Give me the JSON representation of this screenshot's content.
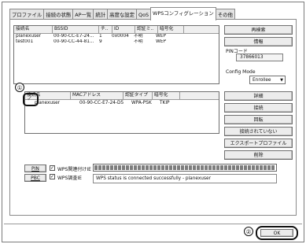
{
  "tabs": [
    "プロファイル",
    "接続の状態",
    "AP一覧",
    "統計",
    "高度な設定",
    "QoS",
    "WPSコンフィグレーション",
    "その他"
  ],
  "active_tab": 6,
  "ap_table": {
    "headers": [
      "接続名",
      "BSSID",
      "チ..",
      "ID",
      "認証ミ..",
      "暗号化"
    ],
    "rows": [
      [
        "planexuser",
        "00-90-CC-E7-24...",
        "1",
        "0x0004",
        "不明",
        "WEP"
      ],
      [
        "test001",
        "00-90-CC-44-81...",
        "9",
        "",
        "不明",
        "WEP"
      ]
    ]
  },
  "right_panel": {
    "rescan": "再検索",
    "info": "情報",
    "pin_code_label": "PINコード",
    "pin_code": "37866013",
    "config_mode_label": "Config Mode",
    "config_mode_value": "Enrollee"
  },
  "profile_table": {
    "headers": [
      "接続名",
      "MACアドレス",
      "認証タイプ",
      "暗号化"
    ],
    "rows": [
      [
        "planexuser",
        "00-90-CC-E7-24-D5",
        "WPA-PSK",
        "TKIP"
      ]
    ]
  },
  "profile_buttons": [
    "詳細",
    "接続",
    "回転",
    "接続されていない",
    "エクスポートプロファイル",
    "削除"
  ],
  "wps": {
    "pin_button": "PIN",
    "pbc_button": "PBC",
    "check1_label": "WPS関連付けIE",
    "check2_label": "WPS調査IE",
    "status_message": "WPS status is connected successfully - planexuser"
  },
  "ok_button": "OK",
  "markers": {
    "one": "①",
    "two": "②"
  }
}
